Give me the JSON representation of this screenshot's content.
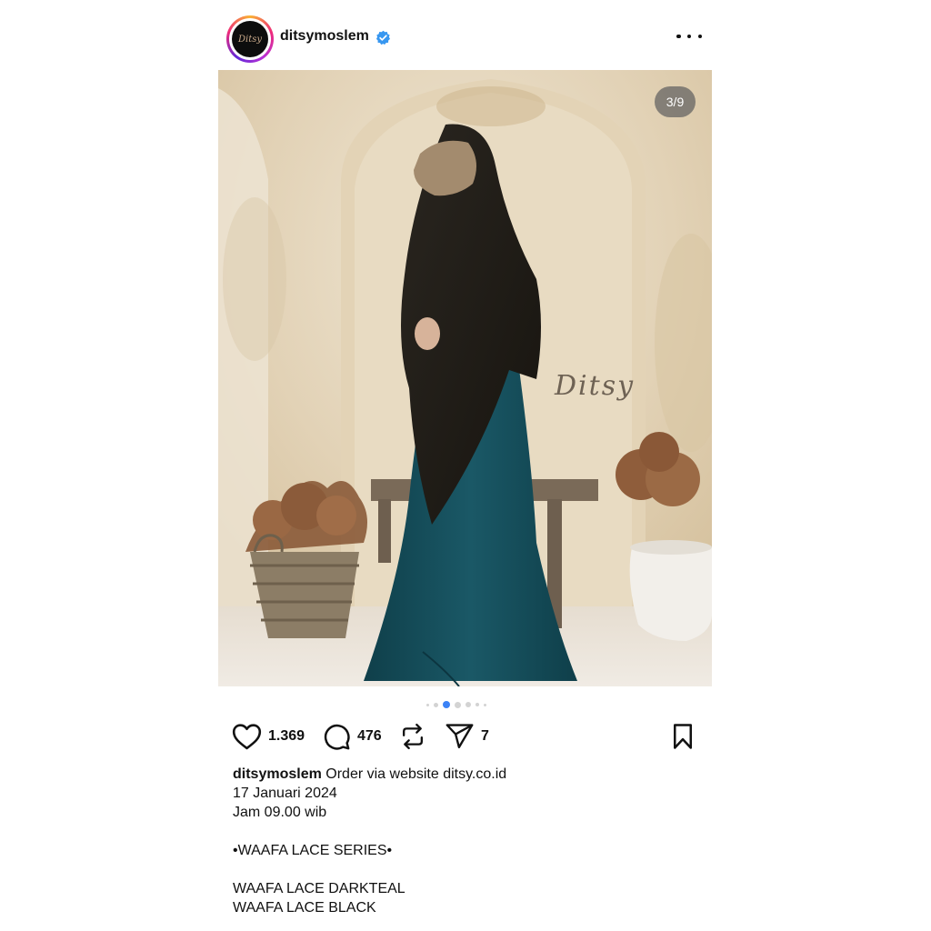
{
  "header": {
    "username": "ditsymoslem",
    "verified": true,
    "avatar_logo": "Ditsy",
    "more_icon": "more-horizontal-icon"
  },
  "post": {
    "counter": "3/9",
    "current_slide": 3,
    "total_slides": 9,
    "watermark": "Ditsy",
    "accent_color": "#3b82f6"
  },
  "actions": {
    "likes": "1.369",
    "comments": "476",
    "shares": "7",
    "icons": [
      "heart-icon",
      "comment-icon",
      "repost-icon",
      "share-icon",
      "bookmark-icon"
    ]
  },
  "caption": {
    "username": "ditsymoslem",
    "first_line": "Order via website ditsy.co.id",
    "lines": [
      "17 Januari 2024",
      "Jam 09.00 wib",
      "",
      "•WAAFA LACE SERIES•",
      "",
      "WAAFA LACE DARKTEAL",
      "WAAFA LACE BLACK"
    ]
  }
}
